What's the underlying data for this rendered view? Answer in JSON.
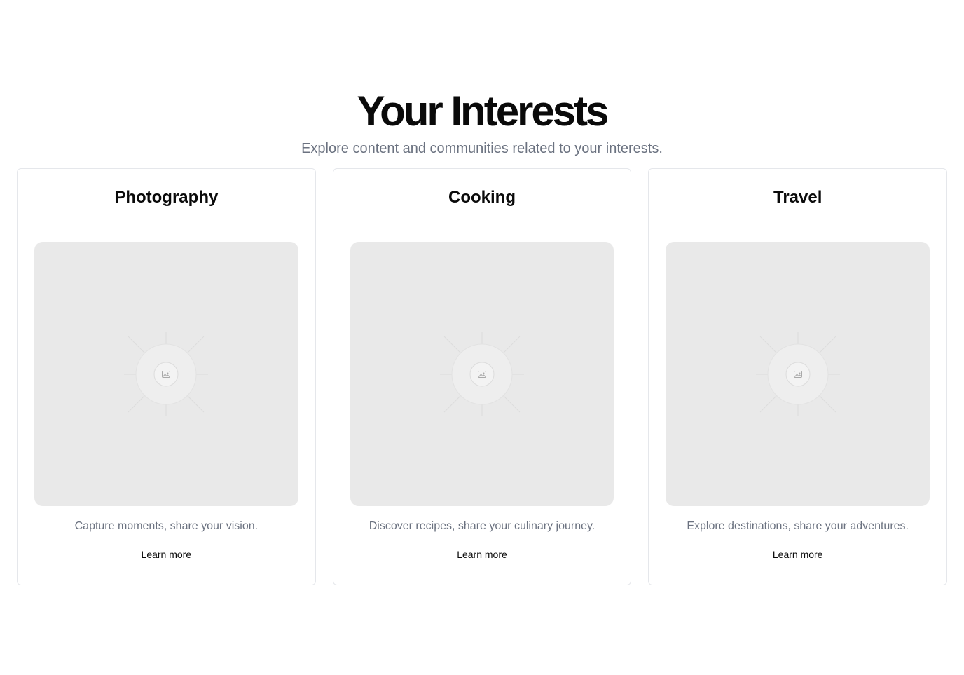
{
  "header": {
    "title": "Your Interests",
    "subtitle": "Explore content and communities related to your interests."
  },
  "cards": [
    {
      "title": "Photography",
      "image_icon": "image-placeholder-icon",
      "description": "Capture moments, share your vision.",
      "link_label": "Learn more"
    },
    {
      "title": "Cooking",
      "image_icon": "image-placeholder-icon",
      "description": "Discover recipes, share your culinary journey.",
      "link_label": "Learn more"
    },
    {
      "title": "Travel",
      "image_icon": "image-placeholder-icon",
      "description": "Explore destinations, share your adventures.",
      "link_label": "Learn more"
    }
  ],
  "colors": {
    "text": "#0a0a0a",
    "muted_text": "#6b7280",
    "card_border": "#e5e7eb",
    "placeholder_bg": "#e9e9e9"
  }
}
